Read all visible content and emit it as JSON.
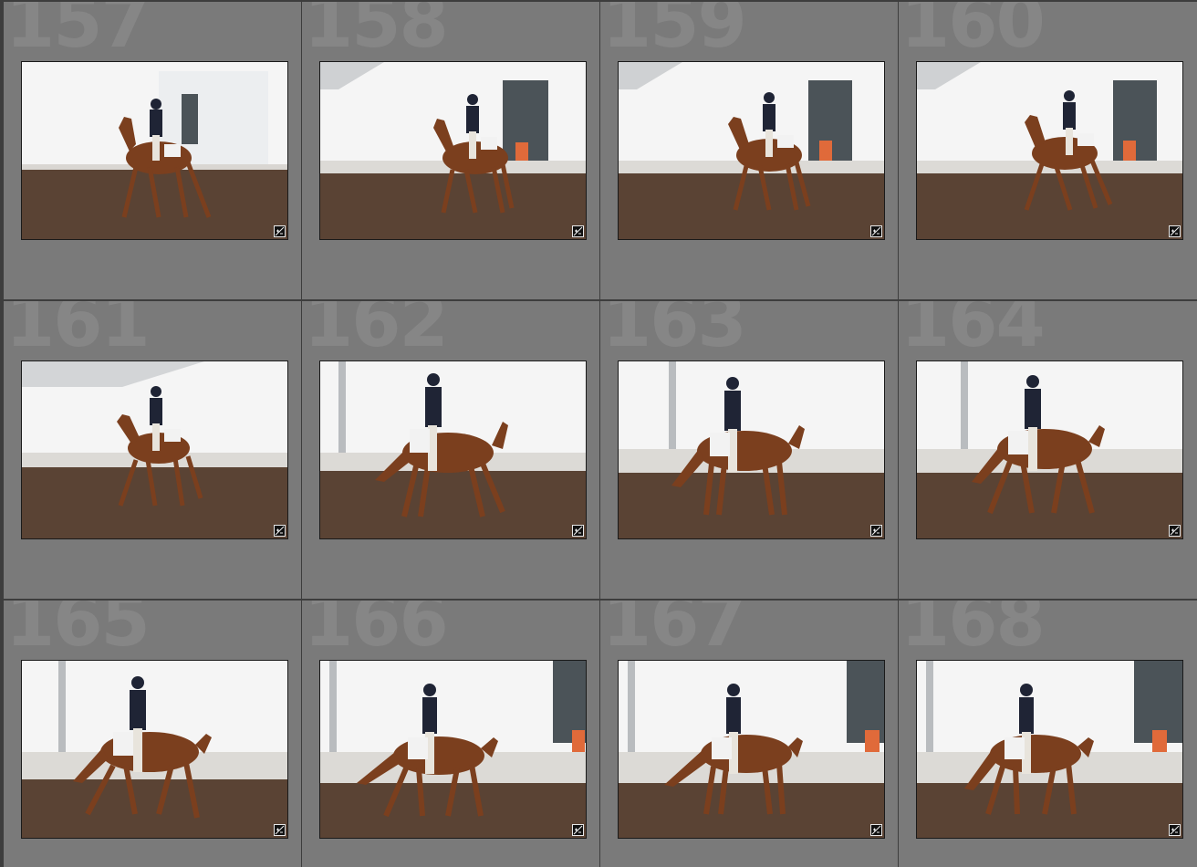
{
  "grid": {
    "cells": [
      {
        "index": "157",
        "photo_icon": "horse-rider-photo",
        "badge_icon": "develop-adjustments-icon"
      },
      {
        "index": "158",
        "photo_icon": "horse-rider-photo",
        "badge_icon": "develop-adjustments-icon"
      },
      {
        "index": "159",
        "photo_icon": "horse-rider-photo",
        "badge_icon": "develop-adjustments-icon"
      },
      {
        "index": "160",
        "photo_icon": "horse-rider-photo",
        "badge_icon": "develop-adjustments-icon"
      },
      {
        "index": "161",
        "photo_icon": "horse-rider-photo",
        "badge_icon": "develop-adjustments-icon"
      },
      {
        "index": "162",
        "photo_icon": "horse-rider-photo",
        "badge_icon": "develop-adjustments-icon"
      },
      {
        "index": "163",
        "photo_icon": "horse-rider-photo",
        "badge_icon": "develop-adjustments-icon"
      },
      {
        "index": "164",
        "photo_icon": "horse-rider-photo",
        "badge_icon": "develop-adjustments-icon"
      },
      {
        "index": "165",
        "photo_icon": "horse-rider-photo",
        "badge_icon": "develop-adjustments-icon"
      },
      {
        "index": "166",
        "photo_icon": "horse-rider-photo",
        "badge_icon": "develop-adjustments-icon"
      },
      {
        "index": "167",
        "photo_icon": "horse-rider-photo",
        "badge_icon": "develop-adjustments-icon"
      },
      {
        "index": "168",
        "photo_icon": "horse-rider-photo",
        "badge_icon": "develop-adjustments-icon"
      }
    ]
  },
  "colors": {
    "background": "#7a7a7a",
    "grid_line": "#3d3d3d",
    "index_number": "#868686",
    "arena_dirt": "#5a4334",
    "horse": "#7b3f1e",
    "rider_jacket": "#1f2435",
    "sky": "#f4f4f4"
  }
}
